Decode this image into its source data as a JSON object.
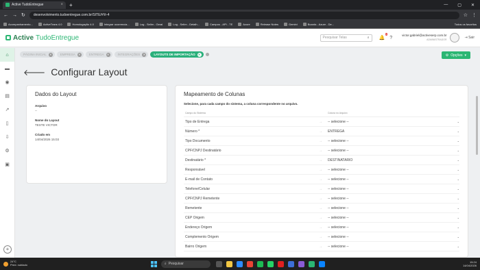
{
  "browser": {
    "tab_title": "Active TudoEntregue",
    "url": "desenvolvimento.tudoentregue.com.br/SITE/#!/r-4",
    "bookmarks": [
      "Acompanhamento...",
      "ActiveTrans 4.0",
      "Homologação 4.0",
      "Integrar ocorrencia...",
      "Log - Selim - Geral",
      "Log - Selim - Detalh...",
      "Campos - API - TE",
      "Azure",
      "Release Notes",
      "Gemini",
      "Boards - Azure - De..."
    ],
    "bookmarks_right": "Todos os favoritos"
  },
  "header": {
    "logo_bold": "Active",
    "logo_light": "TudoEntregue",
    "search_placeholder": "Pesquisar Telas",
    "bell_count": "0",
    "user_email": "victor.gabriel@activeserp.com.br",
    "user_role": "ADMINISTRADOR",
    "sair": "Sair"
  },
  "breadcrumb": [
    "PÁGINA INICIAL",
    "EMPRESA",
    "ENTREGA",
    "INTEGRAÇÕES",
    "LAYOUTS DE IMPORTAÇÃO"
  ],
  "opcoes": "Opções",
  "page_title": "Configurar Layout",
  "layout_card": {
    "title": "Dados do Layout",
    "fields": [
      {
        "label": "Arquivo",
        "value": "--"
      },
      {
        "label": "Nome do Layout",
        "value": "TESTE VICTOR"
      },
      {
        "label": "Criado em",
        "value": "14/04/2026 15:03"
      }
    ]
  },
  "mapping": {
    "title": "Mapeamento de Colunas",
    "instructions": "Selecione, para cada campo do sistema, a coluna correspondente no arquivo.",
    "col_system": "Campo do Sistema",
    "col_file": "Coluna no Arquivo",
    "rows": [
      {
        "name": "Tipo de Entrega",
        "value": "-- selecione --"
      },
      {
        "name": "Número *",
        "value": "ENTREGA"
      },
      {
        "name": "Tipo Documento",
        "value": "-- selecione --"
      },
      {
        "name": "CPF/CNPJ Destinatário",
        "value": "-- selecione --"
      },
      {
        "name": "Destinatário *",
        "value": "DESTINATARIO"
      },
      {
        "name": "Responsável",
        "value": "-- selecione --"
      },
      {
        "name": "E-mail de Contato",
        "value": "-- selecione --"
      },
      {
        "name": "Telefone/Celular",
        "value": "-- selecione --"
      },
      {
        "name": "CPF/CNPJ Remetente",
        "value": "-- selecione --"
      },
      {
        "name": "Remetente",
        "value": "-- selecione --"
      },
      {
        "name": "CEP Origem",
        "value": "-- selecione --"
      },
      {
        "name": "Endereço Origem",
        "value": "-- selecione --"
      },
      {
        "name": "Complemento Origem",
        "value": "-- selecione --"
      },
      {
        "name": "Bairro Origem",
        "value": "-- selecione --"
      }
    ]
  },
  "taskbar": {
    "temp": "24°C",
    "weather": "Pred. nublado",
    "search": "Pesquisar",
    "time": "15:24",
    "date": "14/04/2026"
  },
  "colors": {
    "accent": "#2bb673"
  }
}
